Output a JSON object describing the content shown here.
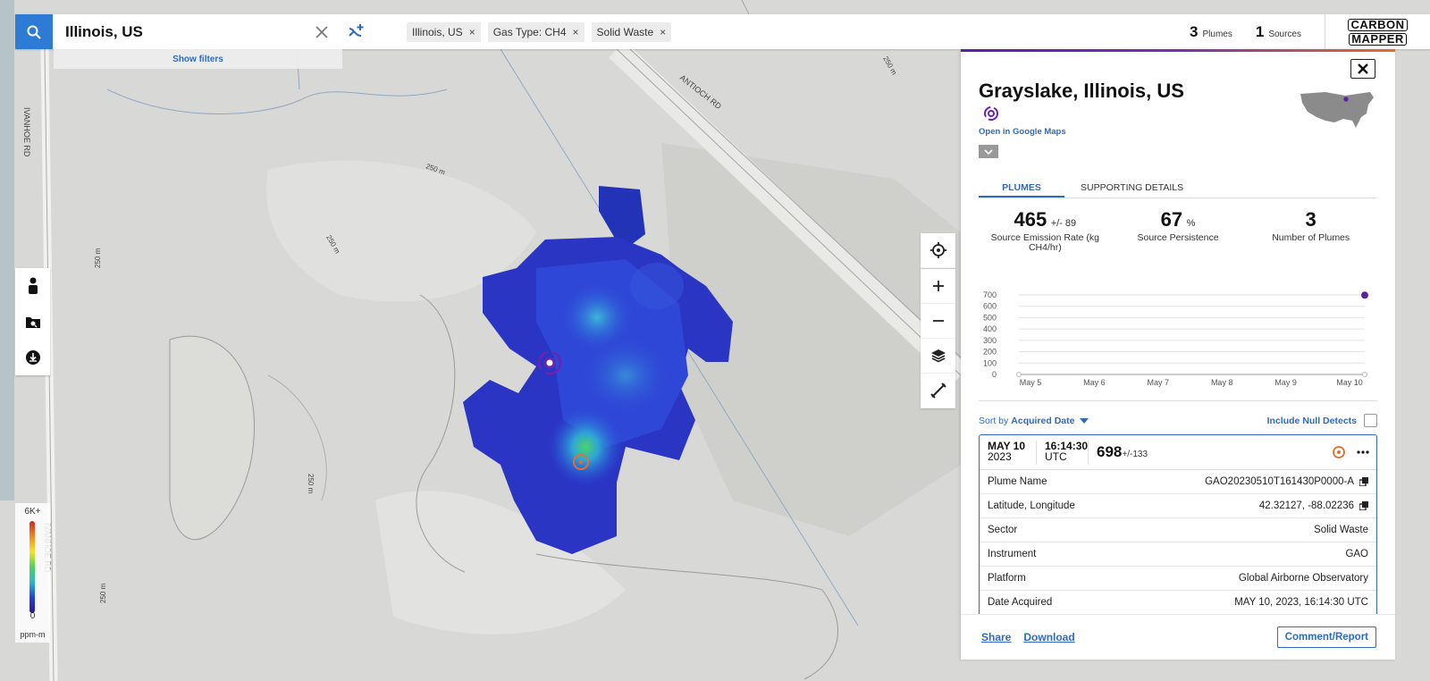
{
  "search": {
    "query": "Illinois, US"
  },
  "filters": {
    "show_filters": "Show filters",
    "chips": [
      {
        "label": "Illinois, US"
      },
      {
        "label": "Gas Type: CH4"
      },
      {
        "label": "Solid Waste"
      }
    ],
    "chip_close": "×"
  },
  "counts": {
    "plumes": {
      "value": "3",
      "label": "Plumes"
    },
    "sources": {
      "value": "1",
      "label": "Sources"
    }
  },
  "logo": {
    "line1": "CARBON",
    "line2": "MAPPER"
  },
  "map": {
    "road_labels": {
      "ivanhoe_1": "IVANHOE RD",
      "ivanhoe_2": "IVANHOE RD",
      "antioch": "ANTIOCH RD"
    },
    "contour_labels": [
      "250 m",
      "250 m",
      "250 m",
      "250 m",
      "250 m",
      "250 m"
    ]
  },
  "legend": {
    "max": "6K+",
    "min": "0",
    "unit": "ppm-m"
  },
  "panel": {
    "title": "Grayslake, Illinois, US",
    "google_maps": "Open in Google Maps",
    "tabs": [
      "PLUMES",
      "SUPPORTING DETAILS"
    ],
    "stats": [
      {
        "value": "465",
        "unit": "+/- 89",
        "label": "Source Emission Rate (kg CH4/hr)"
      },
      {
        "value": "67",
        "unit": "%",
        "label": "Source Persistence"
      },
      {
        "value": "3",
        "unit": "",
        "label": "Number of Plumes"
      }
    ],
    "sort_by": "Sort by",
    "sort_value": "Acquired Date",
    "include_null": "Include Null Detects",
    "plume_card": {
      "date": "MAY 10",
      "year": "2023",
      "time": "16:14:30",
      "tz": "UTC",
      "value": "698",
      "uncertainty": "+/-133",
      "rows": [
        {
          "label": "Plume Name",
          "value": "GAO20230510T161430P0000-A"
        },
        {
          "label": "Latitude, Longitude",
          "value": "42.32127, -88.02236"
        },
        {
          "label": "Sector",
          "value": "Solid Waste"
        },
        {
          "label": "Instrument",
          "value": "GAO"
        },
        {
          "label": "Platform",
          "value": "Global Airborne Observatory"
        },
        {
          "label": "Date Acquired",
          "value": "MAY 10, 2023, 16:14:30 UTC"
        }
      ]
    },
    "footer": {
      "share": "Share",
      "download": "Download",
      "comment": "Comment/Report"
    }
  },
  "chart_data": {
    "type": "line",
    "categories": [
      "May 5",
      "May 6",
      "May 7",
      "May 8",
      "May 9",
      "May 10"
    ],
    "y_ticks": [
      "700",
      "600",
      "500",
      "400",
      "300",
      "200",
      "100",
      "0"
    ],
    "ylim": [
      0,
      700
    ],
    "series": [
      {
        "values": [
          0,
          0,
          0,
          0,
          0,
          0
        ]
      },
      {
        "points": [
          {
            "x": "May 10",
            "y": 698
          }
        ]
      }
    ],
    "grid": true,
    "point_color": "#5b1fa6",
    "baseline_color": "#bbbbbb"
  },
  "colors": {
    "accent": "#2e7bd6",
    "link": "#2e6bbf",
    "source_marker": "#6a24b0",
    "plume_marker": "#e0702a"
  }
}
